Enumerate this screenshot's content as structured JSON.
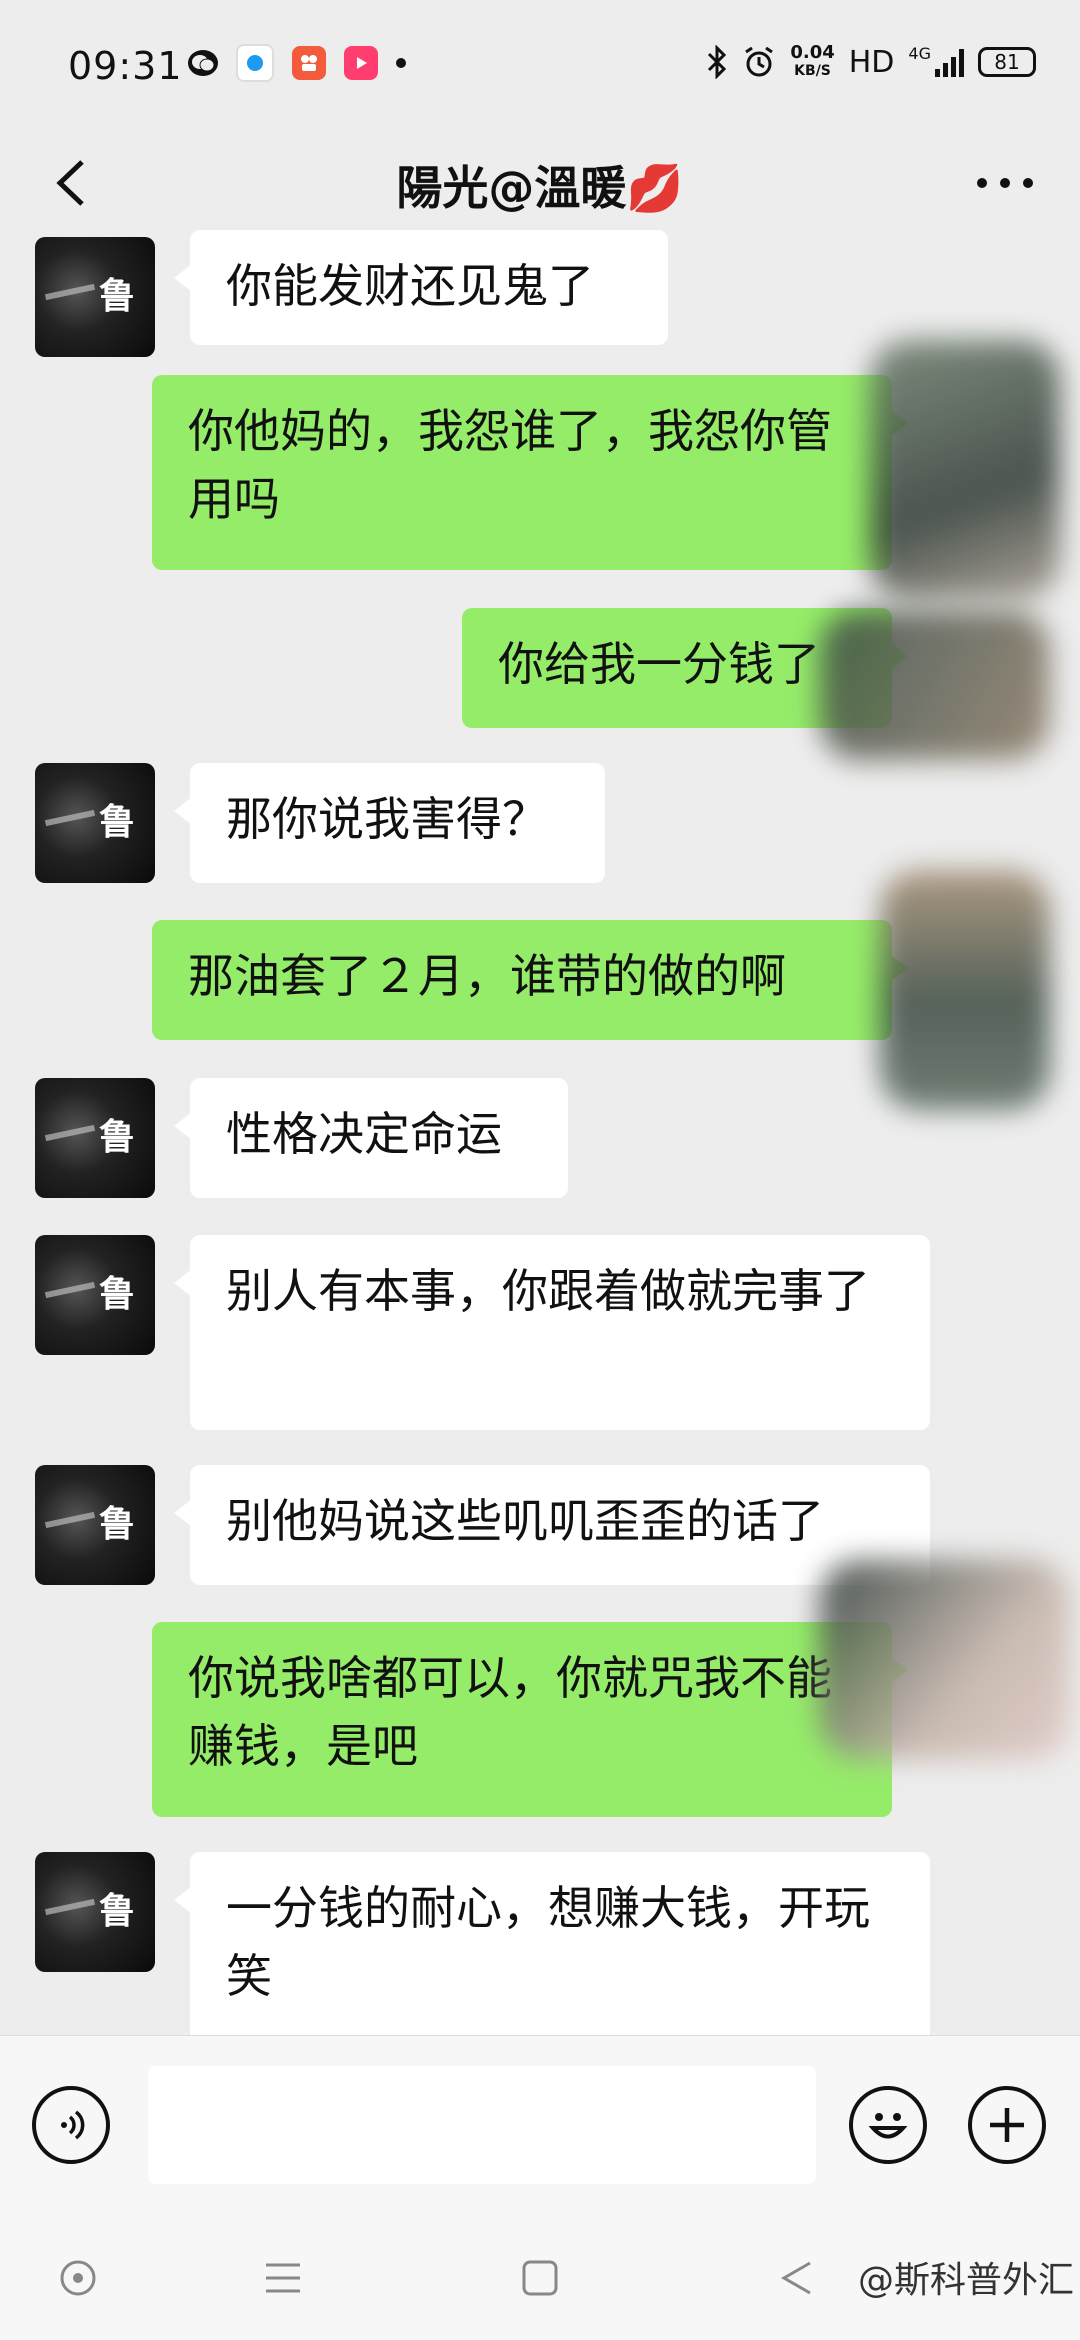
{
  "status_bar": {
    "time": "09:31",
    "speed_value": "0.04",
    "speed_unit": "KB/S",
    "hd": "HD",
    "network": "4G",
    "battery": "81"
  },
  "header": {
    "title": "陽光@溫暖💋"
  },
  "messages": [
    {
      "side": "in",
      "text": "你能发财还见鬼了"
    },
    {
      "side": "out",
      "text": "你他妈的，我怨谁了，我怨你管用吗"
    },
    {
      "side": "out",
      "text": "你给我一分钱了"
    },
    {
      "side": "in",
      "text": "那你说我害得？"
    },
    {
      "side": "out",
      "text": "那油套了２月，谁带的做的啊"
    },
    {
      "side": "in",
      "text": "性格决定命运"
    },
    {
      "side": "in",
      "text": "别人有本事，你跟着做就完事了"
    },
    {
      "side": "in",
      "text": "别他妈说这些叽叽歪歪的话了"
    },
    {
      "side": "out",
      "text": "你说我啥都可以，你就咒我不能赚钱，是吧"
    },
    {
      "side": "in",
      "text": "一分钱的耐心，想赚大钱，开玩笑"
    }
  ],
  "avatar_glyph": "鲁",
  "input_bar": {
    "placeholder": ""
  },
  "watermark": "@斯科普外汇",
  "colors": {
    "background": "#ededed",
    "outgoing_bubble": "#95ec69",
    "incoming_bubble": "#ffffff"
  }
}
